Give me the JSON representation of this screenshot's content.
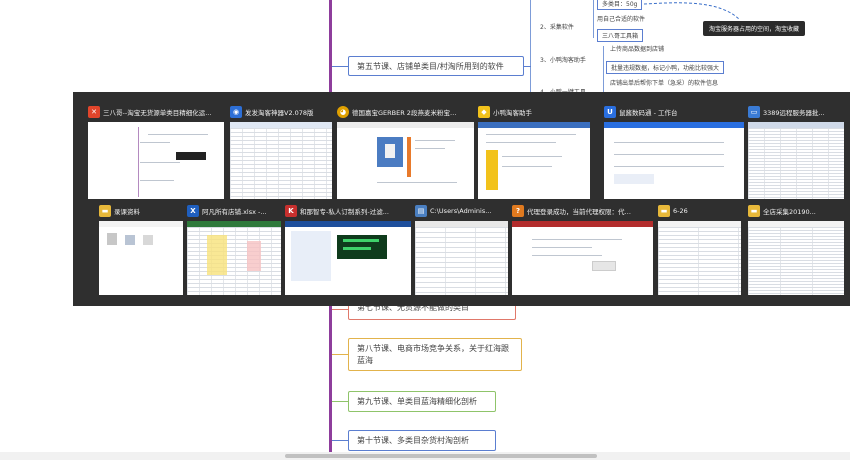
{
  "mindmap": {
    "nodes": {
      "lesson5": "第五节课、店铺单类目/村淘所用到的软件",
      "lesson7": "第七节课、无货源不能做的类目",
      "lesson8": "第八节课、电商市场竞争关系，关于红海跟蓝海",
      "lesson9": "第九节课、单类目蓝海精细化剖析",
      "lesson10": "第十节课、多类目杂货村淘剖析"
    },
    "subs": {
      "top_item": "多类目：50g",
      "item2": "2、采集软件",
      "item2a": "用自己合适的软件",
      "item2b": "三八哥工具箱",
      "item3": "3、小鸭淘客助手",
      "item3a": "上传商品数据到店铺",
      "item3b": "批量违规数据，标记小鸭，功能比较强大",
      "item3c": "店铺出单后帮你下单（急采）的软件信息",
      "item4": "4、小鸭一键工具"
    },
    "tag": "淘宝服务器占用的空间，淘宝收藏"
  },
  "switcher": {
    "row1": [
      {
        "title": "三八哥--淘宝无货源单类目精细化运...",
        "icon": "x-app-icon",
        "color": "#e2452b",
        "glyph": "✕"
      },
      {
        "title": "发发淘客神器V2.078版",
        "icon": "robot-icon",
        "color": "#2d6fd6",
        "glyph": "◉"
      },
      {
        "title": "德国嘉宝GERBER 2段燕麦米粉宝宝...",
        "icon": "chrome-icon",
        "color": "#e0a000",
        "glyph": "◕"
      },
      {
        "title": "小鸭淘客助手",
        "icon": "duck-icon",
        "color": "#f2c21b",
        "glyph": "◆"
      },
      {
        "title": "鼠酱数码通 - 工作台",
        "icon": "u-app-icon",
        "color": "#2a6fe0",
        "glyph": "U"
      },
      {
        "title": "3389远程服务器批...",
        "icon": "monitor-icon",
        "color": "#3a7bd5",
        "glyph": "▭"
      }
    ],
    "row2": [
      {
        "title": "录课资料",
        "icon": "folder-icon",
        "color": "#e7b83a",
        "glyph": "▬"
      },
      {
        "title": "阿凡所有店铺.xlsx -...",
        "icon": "excel-icon",
        "color": "#1f5fbf",
        "glyph": "X"
      },
      {
        "title": "和那智专-私人订制系列-过滤...",
        "icon": "pk-app-icon",
        "color": "#c8302e",
        "glyph": "K"
      },
      {
        "title": "C:\\Users\\Adminis...",
        "icon": "explorer-icon",
        "color": "#4a7fc1",
        "glyph": "▤"
      },
      {
        "title": "代理登录成功，当前代理权限：代理...",
        "icon": "proxy-icon",
        "color": "#e07a1f",
        "glyph": "?"
      },
      {
        "title": "6-26",
        "icon": "folder-icon",
        "color": "#e7b83a",
        "glyph": "▬"
      },
      {
        "title": "全店采集20190...",
        "icon": "folder-icon",
        "color": "#e7b83a",
        "glyph": "▬"
      }
    ]
  }
}
